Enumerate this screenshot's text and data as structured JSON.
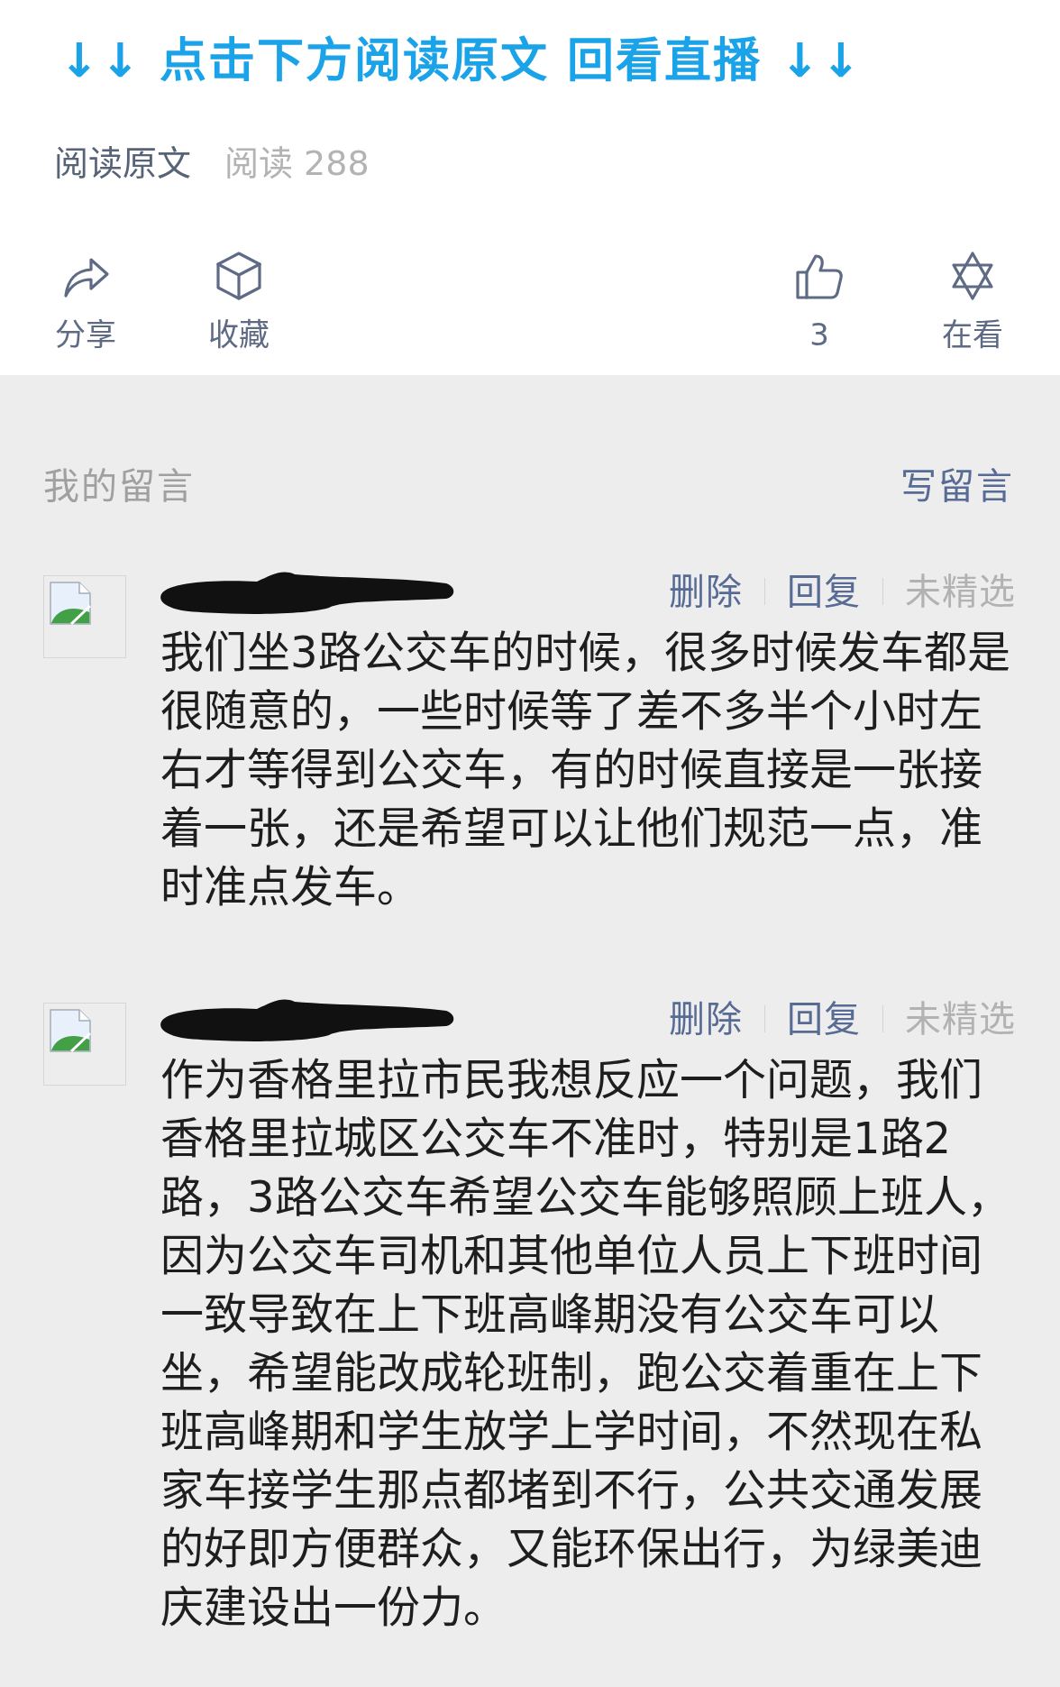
{
  "article_footer": {
    "banner": "↓↓ 点击下方阅读原文 回看直播 ↓↓",
    "read_original_link": "阅读原文",
    "read_count": "阅读 288",
    "actions": {
      "left": [
        {
          "kind": "share",
          "label": "分享"
        },
        {
          "kind": "favorite",
          "label": "收藏"
        }
      ],
      "right": [
        {
          "kind": "like",
          "label": "3"
        },
        {
          "kind": "watching",
          "label": "在看"
        }
      ]
    }
  },
  "comments_section": {
    "title": "我的留言",
    "write_button": "写留言",
    "comments": [
      {
        "text": "我们坐3路公交车的时候，很多时候发车都是很随意的，一些时候等了差不多半个小时左右才等得到公交车，有的时候直接是一张接着一张，还是希望可以让他们规范一点，准时准点发车。",
        "actions": [
          {
            "label": "删除",
            "disabled": false
          },
          {
            "label": "回复",
            "disabled": false
          },
          {
            "label": "未精选",
            "disabled": true
          }
        ]
      },
      {
        "text": "作为香格里拉市民我想反应一个问题，我们香格里拉城区公交车不准时，特别是1路2路，3路公交车希望公交车能够照顾上班人，因为公交车司机和其他单位人员上下班时间一致导致在上下班高峰期没有公交车可以坐，希望能改成轮班制，跑公交着重在上下班高峰期和学生放学上学时间，不然现在私家车接学生那点都堵到不行，公共交通发展的好即方便群众，又能环保出行，为绿美迪庆建设出一份力。",
        "actions": [
          {
            "label": "删除",
            "disabled": false
          },
          {
            "label": "回复",
            "disabled": false
          },
          {
            "label": "未精选",
            "disabled": true
          }
        ]
      }
    ]
  }
}
